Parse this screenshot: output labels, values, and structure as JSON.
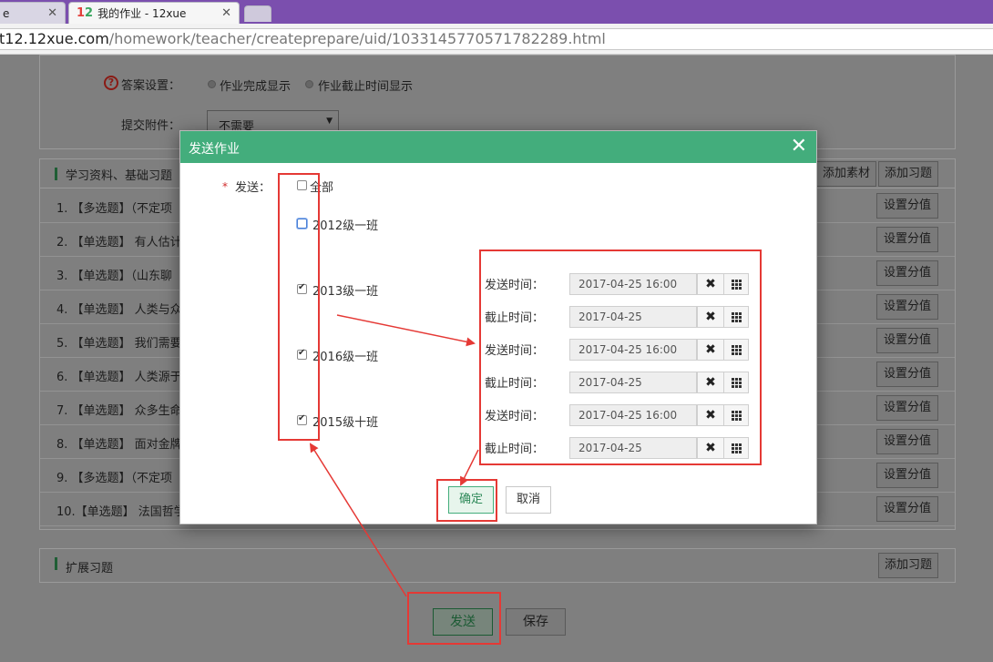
{
  "browser": {
    "tabs": [
      {
        "label": "e"
      },
      {
        "label": "我的作业 - 12xue",
        "logo": "12"
      },
      {
        "label": ""
      }
    ],
    "url_host": "t12.12xue.com",
    "url_path": "/homework/teacher/createprepare/uid/1033145770571782289.html"
  },
  "settings": {
    "answer_label": "答案设置：",
    "answer_options": [
      "作业完成显示",
      "作业截止时间显示"
    ],
    "attachment_label": "提交附件：",
    "attachment_value": "不需要"
  },
  "materials": {
    "title": "学习资料、基础习题",
    "add_material_label": "添加素材",
    "add_exercise_label": "添加习题",
    "set_score_label": "设置分值",
    "questions": [
      "1. 【多选题】（不定项",
      "2. 【单选题】 有人估计",
      "3. 【单选题】（山东聊",
      "4. 【单选题】 人类与众",
      "5. 【单选题】 我们需要",
      "6. 【单选题】 人类源于",
      "7. 【单选题】 众多生命",
      "8. 【单选题】 面对金牌",
      "9. 【多选题】（不定项",
      "10.【单选题】 法国哲学"
    ]
  },
  "extension": {
    "title": "扩展习题",
    "add_exercise_label": "添加习题"
  },
  "footer": {
    "send_label": "发送",
    "save_label": "保存"
  },
  "modal": {
    "title": "发送作业",
    "close_glyph": "✕",
    "required_mark": "*",
    "send_label": "发送：",
    "all_label": "全部",
    "classes": [
      {
        "name": "2012级一班",
        "checked": false
      },
      {
        "name": "2013级一班",
        "checked": true
      },
      {
        "name": "2016级一班",
        "checked": true
      },
      {
        "name": "2015级十班",
        "checked": true
      }
    ],
    "time_rows": [
      {
        "label": "发送时间：",
        "value": "2017-04-25 16:00"
      },
      {
        "label": "截止时间：",
        "value": "2017-04-25"
      },
      {
        "label": "发送时间：",
        "value": "2017-04-25 16:00"
      },
      {
        "label": "截止时间：",
        "value": "2017-04-25"
      },
      {
        "label": "发送时间：",
        "value": "2017-04-25 16:00"
      },
      {
        "label": "截止时间：",
        "value": "2017-04-25"
      }
    ],
    "ok_label": "确定",
    "cancel_label": "取消"
  },
  "colors": {
    "accent": "#43ad7c",
    "annotation": "#e53935",
    "tab_strip": "#7b4fae"
  }
}
